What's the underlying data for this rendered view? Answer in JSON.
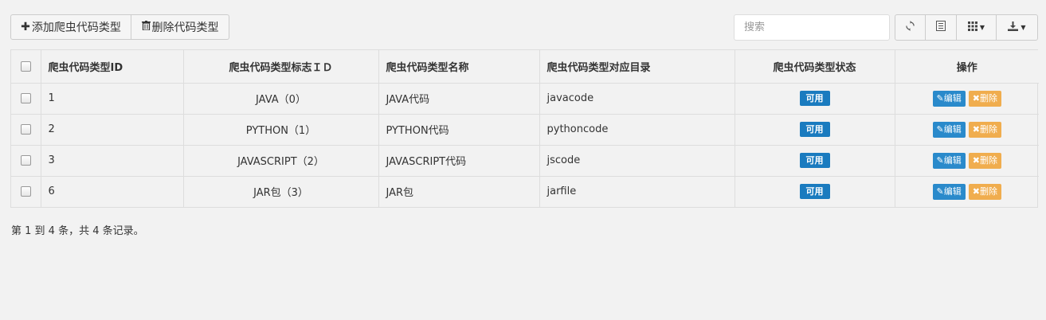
{
  "toolbar": {
    "add_label": "添加爬虫代码类型",
    "delete_label": "删除代码类型",
    "search_placeholder": "搜索",
    "icons": [
      "refresh-icon",
      "list-toggle-icon",
      "columns-icon",
      "export-icon"
    ]
  },
  "table": {
    "headers": [
      "爬虫代码类型ID",
      "爬虫代码类型标志ＩＤ",
      "爬虫代码类型名称",
      "爬虫代码类型对应目录",
      "爬虫代码类型状态",
      "操作"
    ],
    "rows": [
      {
        "id": "1",
        "flag": "JAVA（0）",
        "name": "JAVA代码",
        "dir": "javacode",
        "status": "可用",
        "edit": "编辑",
        "del": "删除"
      },
      {
        "id": "2",
        "flag": "PYTHON（1）",
        "name": "PYTHON代码",
        "dir": "pythoncode",
        "status": "可用",
        "edit": "编辑",
        "del": "删除"
      },
      {
        "id": "3",
        "flag": "JAVASCRIPT（2）",
        "name": "JAVASCRIPT代码",
        "dir": "jscode",
        "status": "可用",
        "edit": "编辑",
        "del": "删除"
      },
      {
        "id": "6",
        "flag": "JAR包（3）",
        "name": "JAR包",
        "dir": "jarfile",
        "status": "可用",
        "edit": "编辑",
        "del": "删除"
      }
    ]
  },
  "footer": {
    "summary": "第 1 到 4 条，共 4 条记录。"
  },
  "colors": {
    "status": "#1a7bbf",
    "edit": "#2a8acb",
    "delete": "#f0ad4e"
  }
}
